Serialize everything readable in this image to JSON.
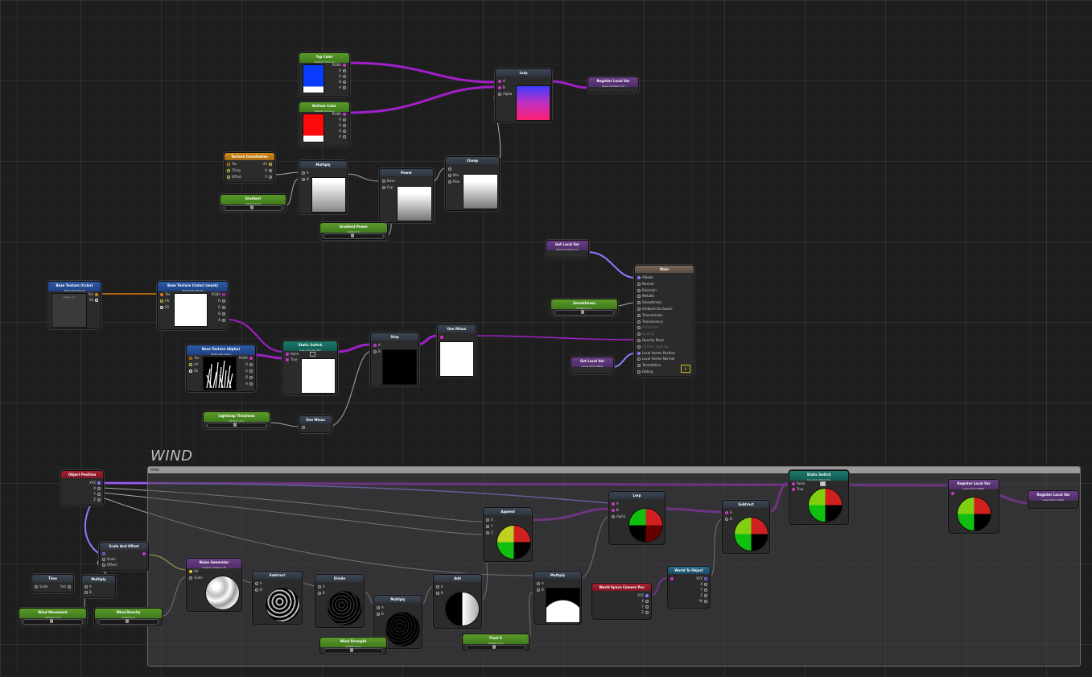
{
  "colors": {
    "wire_color": "#a020c8",
    "wire_vector": "#8a7cff",
    "wire_scalar": "#9a9a9a",
    "wire_orange": "#e07a10"
  },
  "group": {
    "title": "WIND",
    "bar_label": "WIND"
  },
  "nodes": {
    "top_color": {
      "title": "Top Color",
      "subtitle": "Default (0.0.0.1)",
      "pins": [
        "RGBA",
        "R",
        "G",
        "B",
        "A"
      ]
    },
    "bottom_color": {
      "title": "Bottom Color",
      "subtitle": "Default (1.0.0.1)",
      "pins": [
        "RGBA",
        "R",
        "G",
        "B",
        "A"
      ]
    },
    "lerp_top": {
      "title": "Lerp",
      "pins": [
        "A",
        "B",
        "Alpha"
      ]
    },
    "register_local_var_top": {
      "title": "Register Local Var",
      "subtitle": "Grass Gradient Col"
    },
    "texture_coordinates": {
      "title": "Texture Coordinates",
      "pins_in": [
        "Tex",
        "Tiling",
        "Offset"
      ],
      "pins_out": [
        "UV",
        "U",
        "V"
      ]
    },
    "multiply_top": {
      "title": "Multiply",
      "pins": [
        "A",
        "B"
      ]
    },
    "gradient": {
      "title": "Gradient",
      "subtitle": "Default (1.0)"
    },
    "power": {
      "title": "Power",
      "pins": [
        "Base",
        "Exp"
      ]
    },
    "clamp": {
      "title": "Clamp",
      "pins": [
        "",
        "Min",
        "Max"
      ]
    },
    "gradient_power": {
      "title": "Gradient Power",
      "subtitle": "Default (1)"
    },
    "get_local_var_a": {
      "title": "Get Local Var",
      "subtitle": "Grass Gradient Col"
    },
    "main": {
      "title": "Main",
      "pins": [
        "Albedo",
        "Normal",
        "Emission",
        "Metallic",
        "Smoothness",
        "Ambient Occlusion",
        "Transmission",
        "Translucency",
        "Refraction",
        "Opacity",
        "Opacity Mask",
        "Custom Lighting",
        "Local Vertex Position",
        "Local Vertex Normal",
        "Tessellation",
        "Debug"
      ]
    },
    "smoothness": {
      "title": "Smoothness",
      "subtitle": "Default (0.1)"
    },
    "get_local_var_b": {
      "title": "Get Local Var",
      "subtitle": "Grass Wind Offset"
    },
    "base_texture_object": {
      "title": "Base Texture (Color)",
      "subtitle": "Texture2D Albedo",
      "default": "Grass_Col",
      "pins": [
        "Tex",
        "SS"
      ]
    },
    "base_texture_mask": {
      "title": "Base Texture (Color) (mask)",
      "subtitle": "Texture2D Albedo",
      "pins_in": [
        "Tex",
        "UV",
        "SS"
      ],
      "pins_out": [
        "RGBA",
        "R",
        "G",
        "B",
        "A"
      ]
    },
    "base_texture_alpha": {
      "title": "Base Texture (Alpha)",
      "subtitle": "Texture2D Alpha",
      "pins_in": [
        "Tex",
        "UV",
        "SS"
      ],
      "pins_out": [
        "RGBA",
        "R",
        "G",
        "B",
        "A"
      ]
    },
    "static_switch_mid": {
      "title": "Static Switch",
      "subtitle": "Use_Grid_Pos_Mix",
      "pins": [
        "False",
        "True"
      ]
    },
    "step": {
      "title": "Step",
      "pins": [
        "A",
        "B"
      ]
    },
    "one_minus_a": {
      "title": "One Minus"
    },
    "lightmap_thickness": {
      "title": "Lightmap Thickness",
      "subtitle": "Default (0.2)"
    },
    "one_minus_b": {
      "title": "One Minus"
    },
    "object_position": {
      "title": "Object Position",
      "pins": [
        "XYZ",
        "X",
        "Y",
        "Z"
      ]
    },
    "scale_and_offset": {
      "title": "Scale And Offset",
      "pins": [
        "",
        "Scale",
        "Offset"
      ]
    },
    "time": {
      "title": "Time",
      "pins": [
        "Scale",
        "Out"
      ]
    },
    "multiply_time": {
      "title": "Multiply",
      "pins": [
        "A",
        "B"
      ]
    },
    "wind_movement": {
      "title": "Wind Movement",
      "subtitle": "Default (1.0)"
    },
    "wind_density": {
      "title": "Wind Density",
      "subtitle": "Default (1)"
    },
    "noise_generator": {
      "title": "Noise Generator",
      "subtitle": "Simplex Simplex 2D",
      "pins": [
        "UV",
        "Scale"
      ]
    },
    "subtract_noise": {
      "title": "Subtract",
      "pins": [
        "A",
        "B"
      ]
    },
    "divide": {
      "title": "Divide",
      "pins": [
        "A",
        "B"
      ]
    },
    "multiply_strength": {
      "title": "Multiply",
      "pins": [
        "A",
        "B"
      ]
    },
    "wind_strength": {
      "title": "Wind Strength",
      "subtitle": "Default (0.1)"
    },
    "add": {
      "title": "Add",
      "pins": [
        "A",
        "B"
      ]
    },
    "append": {
      "title": "Append",
      "pins": [
        "X",
        "Y",
        "Z"
      ]
    },
    "multiply_mask": {
      "title": "Multiply",
      "pins": [
        "A",
        "B"
      ]
    },
    "float_value": {
      "title": "Float 0",
      "subtitle": "Default (0.1)"
    },
    "lerp_wind": {
      "title": "Lerp",
      "pins": [
        "A",
        "B",
        "Alpha"
      ]
    },
    "world_space_camera_pos": {
      "title": "World Space Camera Pos",
      "pins": [
        "XYZ",
        "X",
        "Y",
        "Z"
      ]
    },
    "world_to_object": {
      "title": "World To Object",
      "pins": [
        "XYZ",
        "X",
        "Y",
        "Z",
        "W"
      ]
    },
    "subtract_wind": {
      "title": "Subtract",
      "pins": [
        "A",
        "B"
      ]
    },
    "static_switch_wind": {
      "title": "Static Switch",
      "subtitle": "Use_Grid_Wind_Pos",
      "pins": [
        "False",
        "True"
      ]
    },
    "register_local_var_wind": {
      "title": "Register Local Var",
      "subtitle": "Grass Wind Offset"
    },
    "register_local_var_out": {
      "title": "Register Local Var",
      "subtitle": "Grass Wind Offset"
    }
  }
}
